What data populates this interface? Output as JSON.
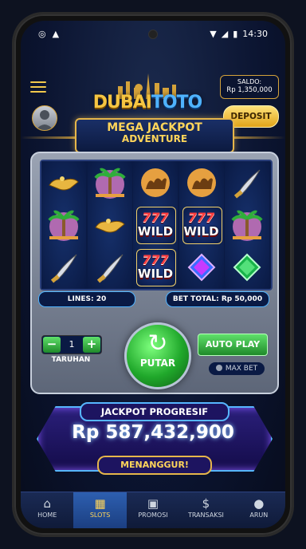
{
  "status_bar": {
    "time": "14:30"
  },
  "header": {
    "brand_part1": "DUBAI",
    "brand_part2": "TOTO",
    "saldo_label": "SALDO:",
    "saldo_value": "Rp 1,350,000",
    "deposit_label": "DEPOSIT"
  },
  "banner": {
    "line1": "MEGA JACKPOT",
    "line2": "ADVENTURE"
  },
  "reels": [
    [
      "lamp",
      "palm",
      "dagger"
    ],
    [
      "palm",
      "lamp",
      "dagger"
    ],
    [
      "camel",
      "wild",
      "wild"
    ],
    [
      "camel",
      "wild",
      "gem-blue"
    ],
    [
      "dagger",
      "palm",
      "gem-green"
    ]
  ],
  "wild_text": "WILD",
  "wild_sevens": "777",
  "controls": {
    "lines": "LINES: 20",
    "bet_total": "BET TOTAL: Rp 50,000",
    "minus": "−",
    "bet_value": "1",
    "plus": "+",
    "taruhan": "TARUHAN",
    "spin": "PUTAR",
    "autoplay": "AUTO PLAY",
    "maxbet": "MAX BET"
  },
  "jackpot": {
    "title": "JACKPOT PROGRESIF",
    "amount": "Rp 587,432,900",
    "cta": "MENANGGUR!"
  },
  "nav": [
    {
      "label": "HOME",
      "icon": "home-icon"
    },
    {
      "label": "SLOTS",
      "icon": "slots-icon"
    },
    {
      "label": "PROMOSI",
      "icon": "gift-icon"
    },
    {
      "label": "TRANSAKSI",
      "icon": "dollar-icon"
    },
    {
      "label": "ARUN",
      "icon": "user-icon"
    }
  ],
  "colors": {
    "gold": "#e6b64a",
    "accent_blue": "#56b6ff",
    "green": "#20a82b"
  }
}
